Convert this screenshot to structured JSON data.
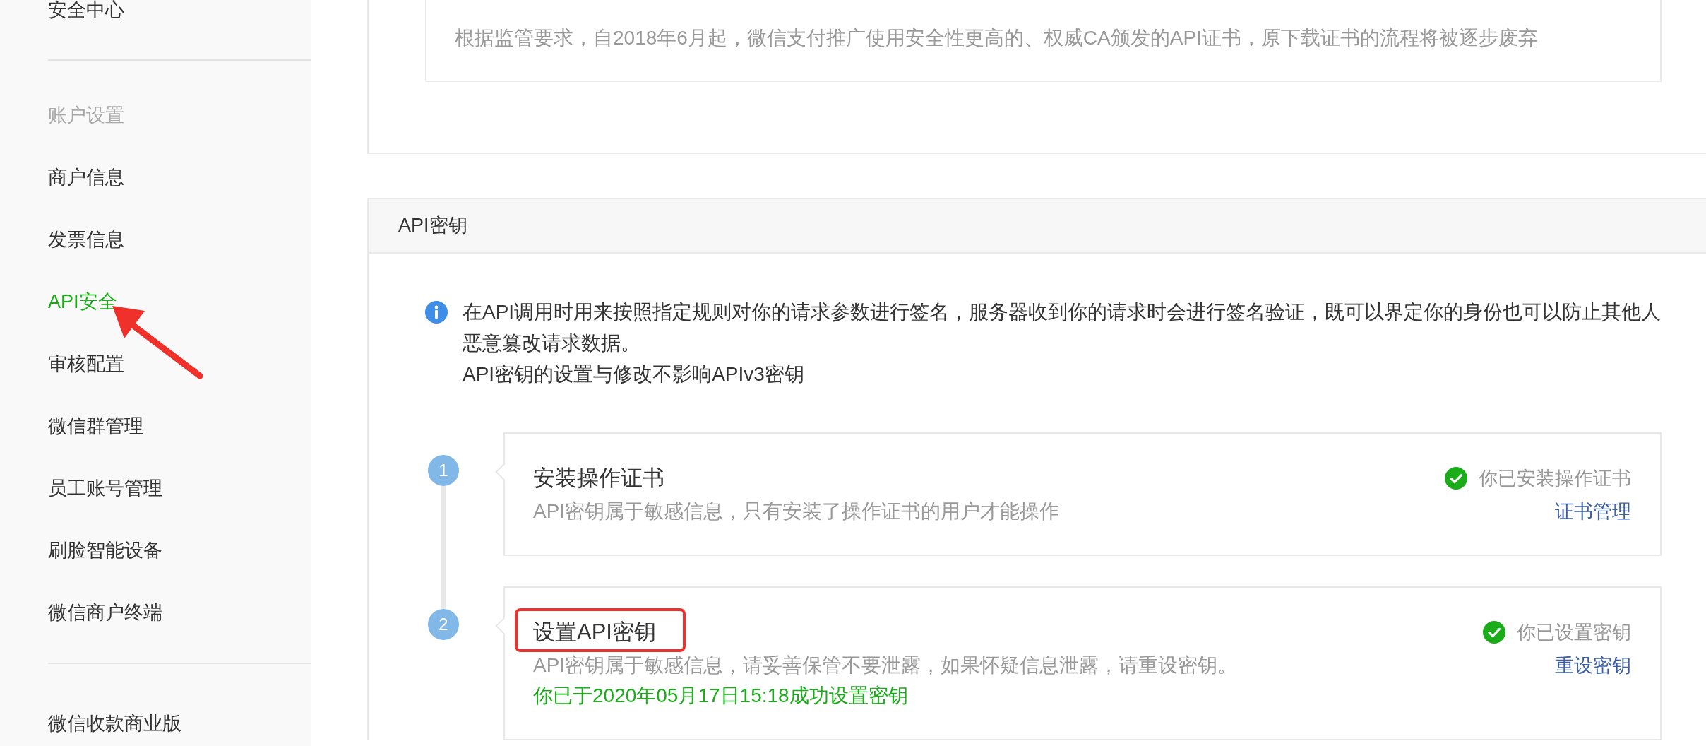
{
  "sidebar": {
    "groups": [
      {
        "items": [
          {
            "label": "安全中心",
            "selected": false,
            "annotated": false
          }
        ]
      },
      {
        "title": "账户设置",
        "items": [
          {
            "label": "商户信息",
            "selected": false,
            "annotated": false
          },
          {
            "label": "发票信息",
            "selected": false,
            "annotated": false
          },
          {
            "label": "API安全",
            "selected": true,
            "annotated": true
          },
          {
            "label": "审核配置",
            "selected": false,
            "annotated": false
          },
          {
            "label": "微信群管理",
            "selected": false,
            "annotated": false
          },
          {
            "label": "员工账号管理",
            "selected": false,
            "annotated": false
          },
          {
            "label": "刷脸智能设备",
            "selected": false,
            "annotated": false
          },
          {
            "label": "微信商户终端",
            "selected": false,
            "annotated": false
          }
        ]
      },
      {
        "items": [
          {
            "label": "微信收款商业版",
            "selected": false,
            "annotated": false
          }
        ]
      }
    ]
  },
  "notice": {
    "text": "根据监管要求，自2018年6月起，微信支付推广使用安全性更高的、权威CA颁发的API证书，原下载证书的流程将被逐步废弃"
  },
  "api_key_panel": {
    "title": "API密钥",
    "info": [
      "在API调用时用来按照指定规则对你的请求参数进行签名，服务器收到你的请求时会进行签名验证，既可以界定你的身份也可以防止其他人恶意篡改请求数据。",
      "API密钥的设置与修改不影响APIv3密钥"
    ],
    "steps": [
      {
        "number": "1",
        "title": "安装操作证书",
        "description": "API密钥属于敏感信息，只有安装了操作证书的用户才能操作",
        "done": true,
        "status": "你已安装操作证书",
        "action": "证书管理",
        "highlighted": false
      },
      {
        "number": "2",
        "title": "设置API密钥",
        "description": "API密钥属于敏感信息，请妥善保管不要泄露，如果怀疑信息泄露，请重设密钥。",
        "note": "你已于2020年05月17日15:18成功设置密钥",
        "done": true,
        "status": "你已设置密钥",
        "action": "重设密钥",
        "highlighted": true
      }
    ]
  }
}
